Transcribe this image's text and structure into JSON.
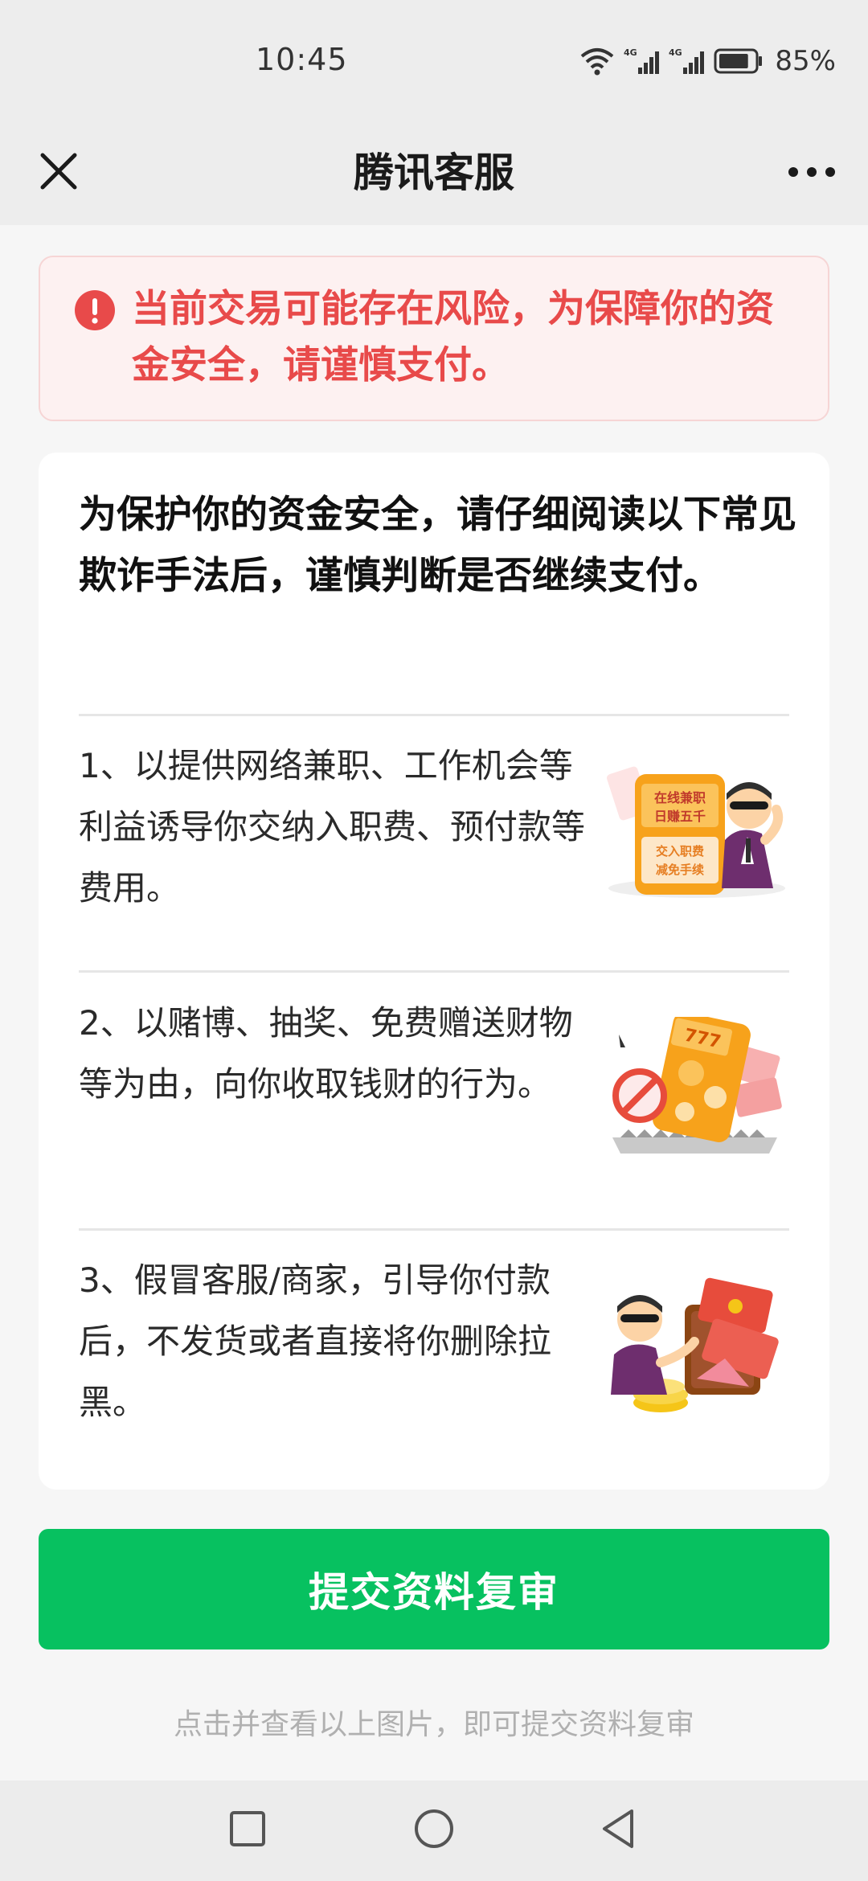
{
  "status_bar": {
    "time": "10:45",
    "battery_percent": "85%",
    "battery_level": 0.85,
    "icons": [
      "wifi-icon",
      "signal-4g-icon",
      "signal-4g-icon",
      "battery-icon"
    ]
  },
  "nav": {
    "title": "腾讯客服",
    "close_icon": "close-icon",
    "more_icon": "more-icon"
  },
  "alert": {
    "icon": "warning-icon",
    "color": "#e84a4a",
    "text": "当前交易可能存在风险，为保障你的资金安全，请谨慎支付。"
  },
  "card": {
    "heading": "为保护你的资金安全，请仔细阅读以下常见欺诈手法后，谨慎判断是否继续支付。",
    "items": [
      {
        "text": "1、以提供网络兼职、工作机会等利益诱导你交纳入职费、预付款等费用。",
        "image_lines": [
          "在线兼职",
          "日赚五千",
          "交入职费",
          "减免手续"
        ]
      },
      {
        "text": "2、以赌博、抽奖、免费赠送财物等为由，向你收取钱财的行为。",
        "image_lines": [
          "777"
        ]
      },
      {
        "text": "3、假冒客服/商家，引导你付款后，不发货或者直接将你删除拉黑。",
        "image_lines": []
      }
    ]
  },
  "submit_button": {
    "label": "提交资料复审",
    "color": "#07c160"
  },
  "hint": "点击并查看以上图片，即可提交资料复审",
  "system_nav": {
    "buttons": [
      "recent-apps-icon",
      "home-icon",
      "back-icon"
    ]
  }
}
